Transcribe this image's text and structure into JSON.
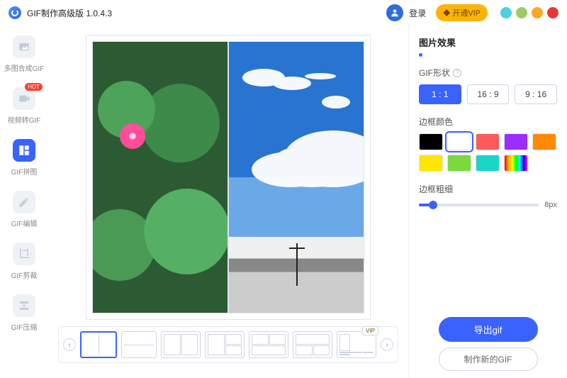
{
  "titlebar": {
    "app_name": "GIF制作高级版 1.0.4.3",
    "login": "登录",
    "vip": "开通VIP"
  },
  "sidebar": {
    "hot": "HOT",
    "items": [
      {
        "label": "多图合成GIF"
      },
      {
        "label": "视频转GIF"
      },
      {
        "label": "GIF拼图"
      },
      {
        "label": "GIF编辑"
      },
      {
        "label": "GIF剪裁"
      },
      {
        "label": "GIF压缩"
      }
    ]
  },
  "layouts": {
    "vip_tag": "VIP"
  },
  "panel": {
    "title": "图片效果",
    "shape_label": "GIF形状",
    "ratios": [
      "1 : 1",
      "16 : 9",
      "9 : 16"
    ],
    "border_color_label": "边框颜色",
    "colors": [
      "#000000",
      "#ffffff",
      "#ff5a5a",
      "#9b2dff",
      "#ff8a00",
      "#ffe600",
      "#7bd93d",
      "#1ad6c8"
    ],
    "selected_color_index": 1,
    "thickness_label": "边框粗细",
    "thickness_value": "8px",
    "export": "导出gif",
    "make_new": "制作新的GIF"
  }
}
